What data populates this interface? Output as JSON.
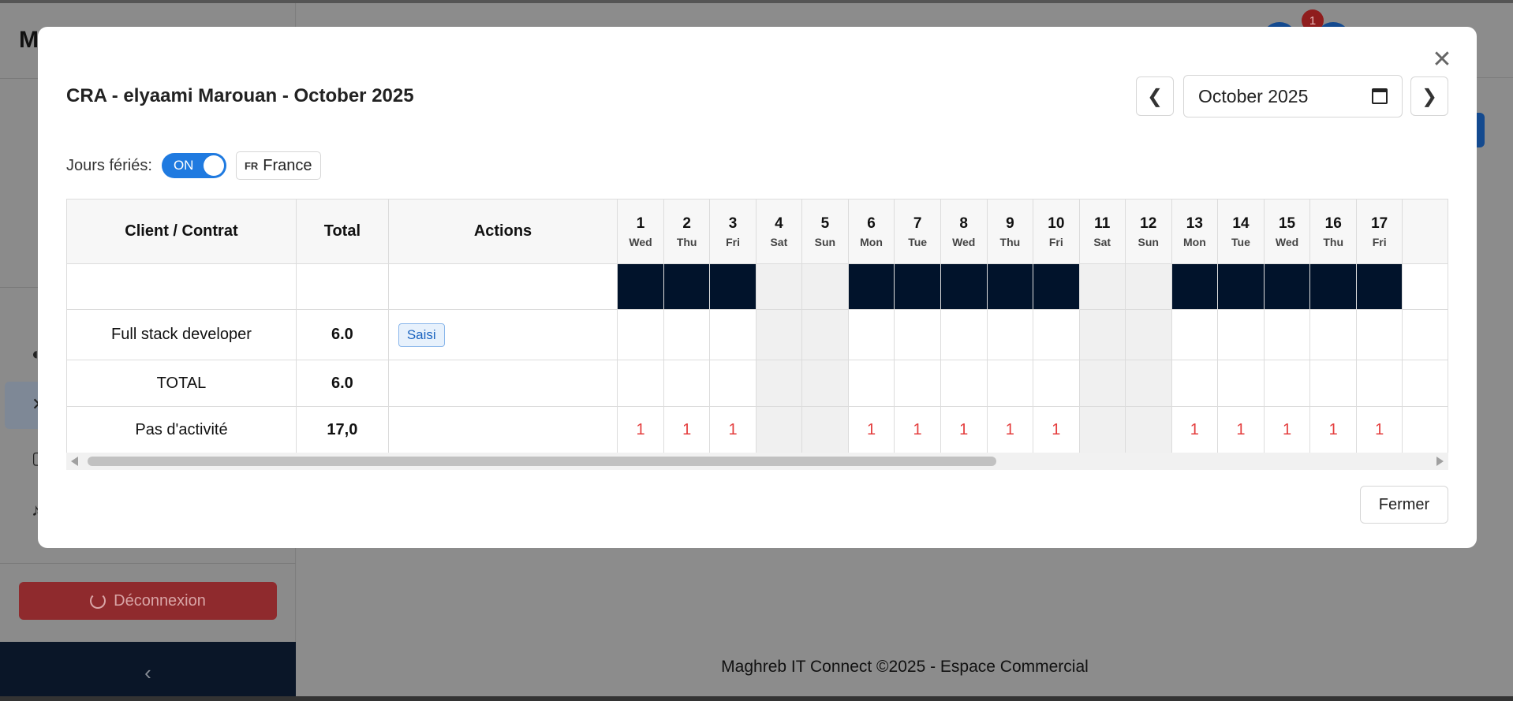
{
  "background": {
    "brand_initial": "M",
    "notification_count": "1",
    "logout_label": "Déconnexion",
    "collapse_glyph": "‹",
    "footer": "Maghreb IT Connect ©2025 - Espace Commercial"
  },
  "modal": {
    "title": "CRA - elyaami Marouan - October 2025",
    "close_glyph": "✕",
    "prev_glyph": "❮",
    "next_glyph": "❯",
    "month_value": "October  2025",
    "holidays_label": "Jours fériés:",
    "toggle_label": "ON",
    "country_code": "FR",
    "country_name": "France",
    "close_button": "Fermer"
  },
  "table": {
    "headers": {
      "client": "Client / Contrat",
      "total": "Total",
      "actions": "Actions"
    },
    "days": [
      {
        "num": "1",
        "name": "Wed"
      },
      {
        "num": "2",
        "name": "Thu"
      },
      {
        "num": "3",
        "name": "Fri"
      },
      {
        "num": "4",
        "name": "Sat"
      },
      {
        "num": "5",
        "name": "Sun"
      },
      {
        "num": "6",
        "name": "Mon"
      },
      {
        "num": "7",
        "name": "Tue"
      },
      {
        "num": "8",
        "name": "Wed"
      },
      {
        "num": "9",
        "name": "Thu"
      },
      {
        "num": "10",
        "name": "Fri"
      },
      {
        "num": "11",
        "name": "Sat"
      },
      {
        "num": "12",
        "name": "Sun"
      },
      {
        "num": "13",
        "name": "Mon"
      },
      {
        "num": "14",
        "name": "Tue"
      },
      {
        "num": "15",
        "name": "Wed"
      },
      {
        "num": "16",
        "name": "Thu"
      },
      {
        "num": "17",
        "name": "Fri"
      }
    ],
    "rows": {
      "contract": {
        "label": "Full stack developer",
        "total": "6.0",
        "badge": "Saisi"
      },
      "total": {
        "label": "TOTAL",
        "total": "6.0"
      },
      "no_activity": {
        "label": "Pas d'activité",
        "total": "17,0",
        "mark": "1"
      }
    }
  },
  "colors": {
    "accent": "#1f7ae0",
    "workday_dark": "#01132b",
    "danger": "#e43d3d",
    "badge_text": "#1d65c0"
  }
}
